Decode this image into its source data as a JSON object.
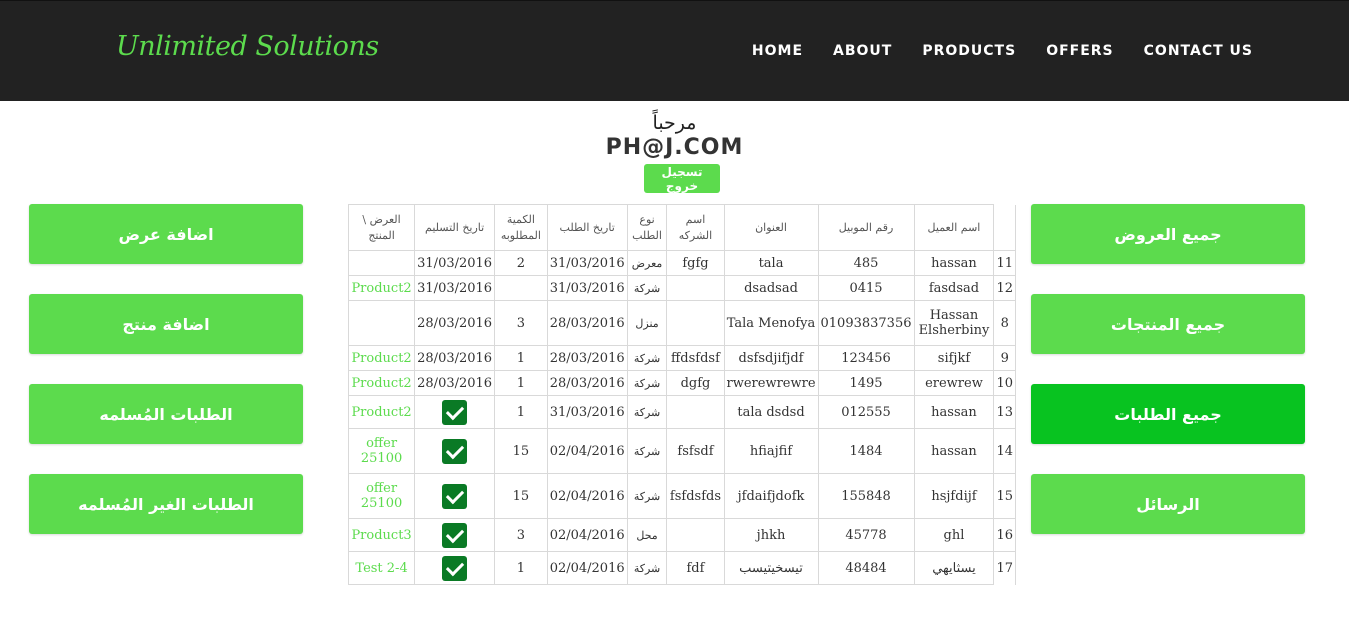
{
  "brand": "Unlimited Solutions",
  "nav": [
    "HOME",
    "ABOUT",
    "PRODUCTS",
    "OFFERS",
    "CONTACT US"
  ],
  "welcome": "مرحباً",
  "user_email": "PH@J.COM",
  "logout_label": "تسجيل خروج",
  "left_buttons": [
    "اضافة عرض",
    "اضافة منتج",
    "الطلبات المُسلمه",
    "الطلبات الغير المُسلمه"
  ],
  "right_buttons": [
    "جميع العروض",
    "جميع المنتجات",
    "جميع الطلبات",
    "الرسائل"
  ],
  "active_right_button": "جميع الطلبات",
  "colors": {
    "accent": "#5cdb4d",
    "accent_active": "#08c320",
    "header_bg": "#222222",
    "check_bg": "#0a7a25"
  },
  "table": {
    "headers": [
      "العرض \\ المنتج",
      "تاريخ التسليم",
      "الكمية المطلوبه",
      "تاريخ الطلب",
      "نوع الطلب",
      "اسم الشركه",
      "العنوان",
      "رقم الموبيل",
      "اسم العميل"
    ],
    "rows": [
      {
        "product": "",
        "delivery": "31/03/2016",
        "qty": "2",
        "order_date": "31/03/2016",
        "type": "معرض",
        "company": "fgfg",
        "address": "tala",
        "mobile": "485",
        "customer": "hassan",
        "id": "11"
      },
      {
        "product": "Product2",
        "delivery": "31/03/2016",
        "qty": "",
        "order_date": "31/03/2016",
        "type": "شركة",
        "company": "",
        "address": "dsadsad",
        "mobile": "0415",
        "customer": "fasdsad",
        "id": "12"
      },
      {
        "product": "",
        "delivery": "28/03/2016",
        "qty": "3",
        "order_date": "28/03/2016",
        "type": "منزل",
        "company": "",
        "address": "Tala Menofya",
        "mobile": "01093837356",
        "customer": "Hassan Elsherbiny",
        "id": "8"
      },
      {
        "product": "Product2",
        "delivery": "28/03/2016",
        "qty": "1",
        "order_date": "28/03/2016",
        "type": "شركة",
        "company": "ffdsfdsf",
        "address": "dsfsdjifjdf",
        "mobile": "123456",
        "customer": "sifjkf",
        "id": "9"
      },
      {
        "product": "Product2",
        "delivery": "28/03/2016",
        "qty": "1",
        "order_date": "28/03/2016",
        "type": "شركة",
        "company": "dgfg",
        "address": "rwerewrewre",
        "mobile": "1495",
        "customer": "erewrew",
        "id": "10"
      },
      {
        "product": "Product2",
        "delivery": "check",
        "qty": "1",
        "order_date": "31/03/2016",
        "type": "شركة",
        "company": "",
        "address": "tala dsdsd",
        "mobile": "012555",
        "customer": "hassan",
        "id": "13"
      },
      {
        "product": "offer 25100",
        "delivery": "check",
        "qty": "15",
        "order_date": "02/04/2016",
        "type": "شركة",
        "company": "fsfsdf",
        "address": "hfiajfif",
        "mobile": "1484",
        "customer": "hassan",
        "id": "14"
      },
      {
        "product": "offer 25100",
        "delivery": "check",
        "qty": "15",
        "order_date": "02/04/2016",
        "type": "شركة",
        "company": "fsfdsfds",
        "address": "jfdaifjdofk",
        "mobile": "155848",
        "customer": "hsjfdijf",
        "id": "15"
      },
      {
        "product": "Product3",
        "delivery": "check",
        "qty": "3",
        "order_date": "02/04/2016",
        "type": "محل",
        "company": "",
        "address": "jhkh",
        "mobile": "45778",
        "customer": "ghl",
        "id": "16"
      },
      {
        "product": "Test 2-4",
        "delivery": "check",
        "qty": "1",
        "order_date": "02/04/2016",
        "type": "شركة",
        "company": "fdf",
        "address": "تيسخيتيسب",
        "mobile": "48484",
        "customer": "يسثايهي",
        "id": "17"
      }
    ]
  }
}
